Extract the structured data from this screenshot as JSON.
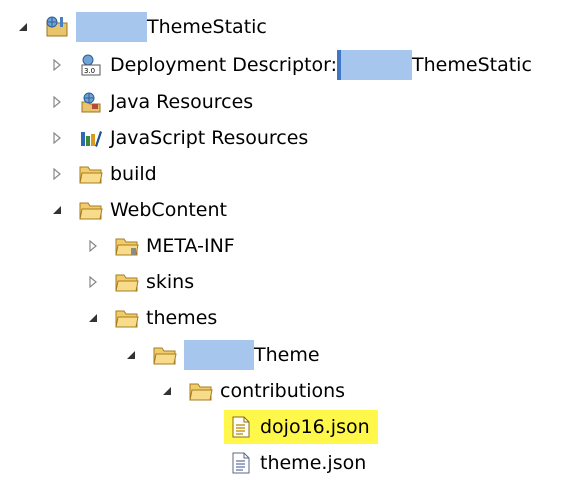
{
  "tree": {
    "project": {
      "name_suffix": "ThemeStatic",
      "children": {
        "deployment_descriptor": {
          "label_prefix": "Deployment Descriptor:",
          "label_suffix": "ThemeStatic"
        },
        "java_resources": {
          "label": "Java Resources"
        },
        "javascript_resources": {
          "label": "JavaScript Resources"
        },
        "build": {
          "label": "build"
        },
        "webcontent": {
          "label": "WebContent",
          "children": {
            "meta_inf": {
              "label": "META-INF"
            },
            "skins": {
              "label": "skins"
            },
            "themes": {
              "label": "themes",
              "children": {
                "theme": {
                  "label_suffix": "Theme",
                  "children": {
                    "contributions": {
                      "label": "contributions",
                      "children": {
                        "dojo16": {
                          "label": "dojo16.json"
                        },
                        "theme_json": {
                          "label": "theme.json"
                        }
                      }
                    }
                  }
                }
              }
            }
          }
        }
      }
    }
  },
  "colors": {
    "highlight": "#fff84a",
    "redaction": "#a6c6ee",
    "folder": "#e8b84a"
  }
}
